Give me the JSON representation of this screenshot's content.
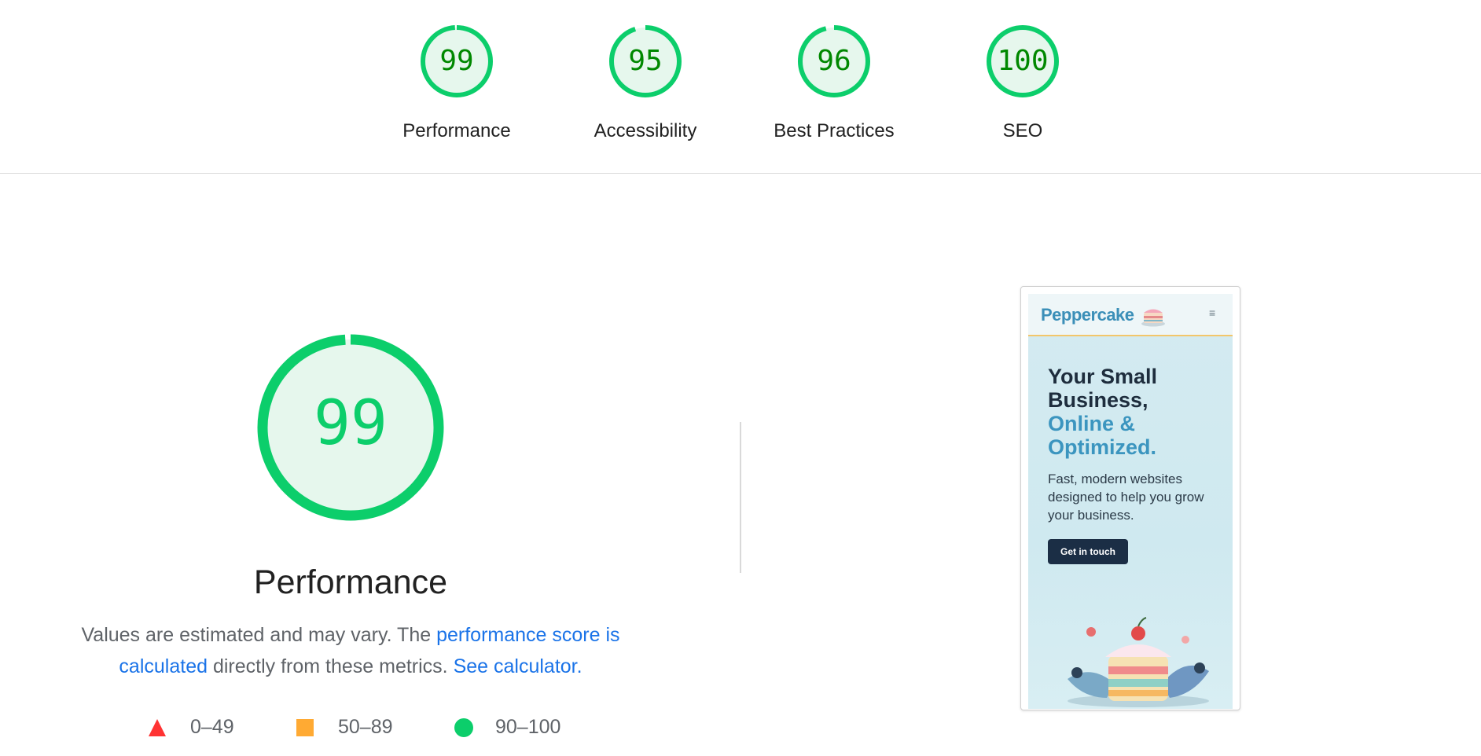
{
  "categories": [
    {
      "label": "Performance",
      "score": "99",
      "value": 0.99
    },
    {
      "label": "Accessibility",
      "score": "95",
      "value": 0.95
    },
    {
      "label": "Best Practices",
      "score": "96",
      "value": 0.96
    },
    {
      "label": "SEO",
      "score": "100",
      "value": 1.0
    }
  ],
  "performance": {
    "score": "99",
    "value": 0.99,
    "title": "Performance",
    "desc_prefix": "Values are estimated and may vary. The ",
    "desc_link1": "performance score is calculated",
    "desc_middle": " directly from these metrics. ",
    "desc_link2": "See calculator."
  },
  "legend": [
    {
      "shape": "triangle",
      "label": "0–49",
      "color": "#ff3333"
    },
    {
      "shape": "square",
      "label": "50–89",
      "color": "#ffaa33"
    },
    {
      "shape": "circle",
      "label": "90–100",
      "color": "#0cce6b"
    }
  ],
  "thumbnail": {
    "brand": "Peppercake",
    "hero_line1": "Your Small",
    "hero_line2": "Business,",
    "hero_line3": "Online &",
    "hero_line4": "Optimized.",
    "subtitle": "Fast, modern websites designed to help you grow your business.",
    "cta": "Get in touch"
  },
  "colors": {
    "pass": "#0cce6b",
    "pass_text": "#008800",
    "pass_fill": "#e6f7ed",
    "link": "#1a73e8"
  }
}
